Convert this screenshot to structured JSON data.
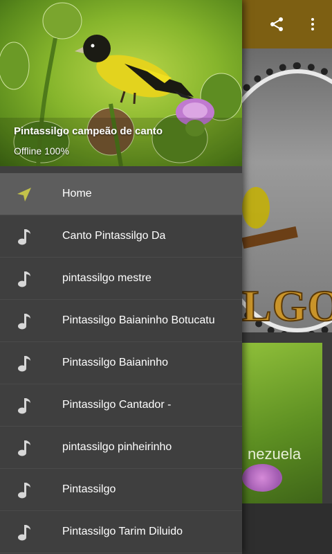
{
  "drawer": {
    "header": {
      "title": "Pintassilgo campeão de canto",
      "subtitle": "Offline 100%"
    },
    "items": [
      {
        "label": "Home",
        "icon": "navigation-arrow-icon",
        "active": true
      },
      {
        "label": "Canto Pintassilgo Da",
        "icon": "music-note-icon"
      },
      {
        "label": "pintassilgo mestre",
        "icon": "music-note-icon"
      },
      {
        "label": "Pintassilgo Baianinho Botucatu",
        "icon": "music-note-icon"
      },
      {
        "label": "Pintassilgo Baianinho",
        "icon": "music-note-icon"
      },
      {
        "label": "Pintassilgo Cantador -",
        "icon": "music-note-icon"
      },
      {
        "label": "pintassilgo pinheirinho",
        "icon": "music-note-icon"
      },
      {
        "label": "Pintassilgo",
        "icon": "music-note-icon"
      },
      {
        "label": "Pintassilgo Tarim Diluido",
        "icon": "music-note-icon"
      }
    ]
  },
  "background": {
    "toolbar_actions": [
      "share-icon",
      "more-vert-icon"
    ],
    "card1_logo_text": "LGO",
    "card2_caption": "nezuela"
  },
  "colors": {
    "toolbar": "#7d5f12",
    "drawer_bg": "#3f3f3f",
    "active_item_bg": "#5d5d5d",
    "home_icon": "#c3c24a",
    "note_icon": "#d7d7d7"
  }
}
